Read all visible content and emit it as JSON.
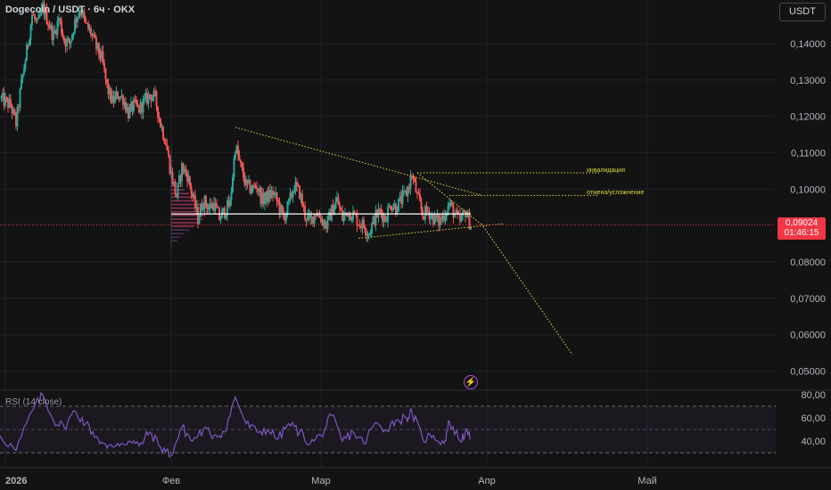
{
  "header": {
    "title": "Dogecoin / USDT · 6ч · OKX"
  },
  "currency_button": "USDT",
  "indicator": {
    "label": "RSI (14 close)"
  },
  "last_price": {
    "value": "0,09024",
    "countdown": "01:46:15"
  },
  "annotations": [
    {
      "text": "инвалидация",
      "price": 0.1045
    },
    {
      "text": "отмена/усложнение",
      "price": 0.0983
    }
  ],
  "colors": {
    "up": "#26a69a",
    "down": "#ef5350",
    "rsi": "#7e57c2",
    "annotation": "#d9d440",
    "level": "#f23645"
  },
  "chart_data": {
    "type": "candlestick",
    "y_axis": {
      "ticks": [
        "0,14000",
        "0,13000",
        "0,12000",
        "0,11000",
        "0,10000",
        "0,08000",
        "0,07000",
        "0,06000",
        "0,05000"
      ],
      "values": [
        0.14,
        0.13,
        0.12,
        0.11,
        0.1,
        0.08,
        0.07,
        0.06,
        0.05
      ],
      "ylim": [
        0.045,
        0.152
      ]
    },
    "x_axis": {
      "ticks": [
        "2026",
        "Фев",
        "Мар",
        "Апр",
        "Май"
      ],
      "dates": [
        "2026-01-01",
        "2026-02-01",
        "2026-03-01",
        "2026-04-01",
        "2026-05-01"
      ],
      "xlim": [
        "2025-12-31",
        "2026-05-25"
      ]
    },
    "close_series": [
      {
        "date": "2025-12-31",
        "price": 0.125
      },
      {
        "date": "2026-01-02",
        "price": 0.123
      },
      {
        "date": "2026-01-03",
        "price": 0.118
      },
      {
        "date": "2026-01-04",
        "price": 0.129
      },
      {
        "date": "2026-01-05",
        "price": 0.138
      },
      {
        "date": "2026-01-06",
        "price": 0.148
      },
      {
        "date": "2026-01-07",
        "price": 0.145
      },
      {
        "date": "2026-01-08",
        "price": 0.15
      },
      {
        "date": "2026-01-09",
        "price": 0.146
      },
      {
        "date": "2026-01-10",
        "price": 0.142
      },
      {
        "date": "2026-01-11",
        "price": 0.147
      },
      {
        "date": "2026-01-12",
        "price": 0.141
      },
      {
        "date": "2026-01-13",
        "price": 0.14
      },
      {
        "date": "2026-01-14",
        "price": 0.146
      },
      {
        "date": "2026-01-15",
        "price": 0.15
      },
      {
        "date": "2026-01-16",
        "price": 0.145
      },
      {
        "date": "2026-01-17",
        "price": 0.143
      },
      {
        "date": "2026-01-18",
        "price": 0.139
      },
      {
        "date": "2026-01-19",
        "price": 0.136
      },
      {
        "date": "2026-01-20",
        "price": 0.128
      },
      {
        "date": "2026-01-21",
        "price": 0.124
      },
      {
        "date": "2026-01-22",
        "price": 0.126
      },
      {
        "date": "2026-01-23",
        "price": 0.125
      },
      {
        "date": "2026-01-24",
        "price": 0.121
      },
      {
        "date": "2026-01-25",
        "price": 0.123
      },
      {
        "date": "2026-01-26",
        "price": 0.122
      },
      {
        "date": "2026-01-27",
        "price": 0.124
      },
      {
        "date": "2026-01-28",
        "price": 0.126
      },
      {
        "date": "2026-01-29",
        "price": 0.125
      },
      {
        "date": "2026-01-30",
        "price": 0.118
      },
      {
        "date": "2026-01-31",
        "price": 0.113
      },
      {
        "date": "2026-02-01",
        "price": 0.104
      },
      {
        "date": "2026-02-02",
        "price": 0.098
      },
      {
        "date": "2026-02-03",
        "price": 0.106
      },
      {
        "date": "2026-02-04",
        "price": 0.104
      },
      {
        "date": "2026-02-05",
        "price": 0.098
      },
      {
        "date": "2026-02-06",
        "price": 0.092
      },
      {
        "date": "2026-02-07",
        "price": 0.097
      },
      {
        "date": "2026-02-08",
        "price": 0.095
      },
      {
        "date": "2026-02-09",
        "price": 0.096
      },
      {
        "date": "2026-02-10",
        "price": 0.092
      },
      {
        "date": "2026-02-11",
        "price": 0.094
      },
      {
        "date": "2026-02-12",
        "price": 0.096
      },
      {
        "date": "2026-02-13",
        "price": 0.112
      },
      {
        "date": "2026-02-14",
        "price": 0.106
      },
      {
        "date": "2026-02-15",
        "price": 0.101
      },
      {
        "date": "2026-02-16",
        "price": 0.1
      },
      {
        "date": "2026-02-17",
        "price": 0.101
      },
      {
        "date": "2026-02-18",
        "price": 0.097
      },
      {
        "date": "2026-02-19",
        "price": 0.098
      },
      {
        "date": "2026-02-20",
        "price": 0.099
      },
      {
        "date": "2026-02-21",
        "price": 0.096
      },
      {
        "date": "2026-02-22",
        "price": 0.092
      },
      {
        "date": "2026-02-23",
        "price": 0.096
      },
      {
        "date": "2026-02-24",
        "price": 0.101
      },
      {
        "date": "2026-02-25",
        "price": 0.099
      },
      {
        "date": "2026-02-26",
        "price": 0.093
      },
      {
        "date": "2026-02-27",
        "price": 0.091
      },
      {
        "date": "2026-02-28",
        "price": 0.094
      },
      {
        "date": "2026-03-01",
        "price": 0.092
      },
      {
        "date": "2026-03-02",
        "price": 0.09
      },
      {
        "date": "2026-03-03",
        "price": 0.094
      },
      {
        "date": "2026-03-04",
        "price": 0.097
      },
      {
        "date": "2026-03-05",
        "price": 0.092
      },
      {
        "date": "2026-03-06",
        "price": 0.094
      },
      {
        "date": "2026-03-07",
        "price": 0.093
      },
      {
        "date": "2026-03-08",
        "price": 0.091
      },
      {
        "date": "2026-03-09",
        "price": 0.09
      },
      {
        "date": "2026-03-10",
        "price": 0.088
      },
      {
        "date": "2026-03-11",
        "price": 0.092
      },
      {
        "date": "2026-03-12",
        "price": 0.094
      },
      {
        "date": "2026-03-13",
        "price": 0.092
      },
      {
        "date": "2026-03-14",
        "price": 0.096
      },
      {
        "date": "2026-03-15",
        "price": 0.095
      },
      {
        "date": "2026-03-16",
        "price": 0.097
      },
      {
        "date": "2026-03-17",
        "price": 0.099
      },
      {
        "date": "2026-03-18",
        "price": 0.104
      },
      {
        "date": "2026-03-19",
        "price": 0.098
      },
      {
        "date": "2026-03-20",
        "price": 0.093
      },
      {
        "date": "2026-03-21",
        "price": 0.094
      },
      {
        "date": "2026-03-22",
        "price": 0.092
      },
      {
        "date": "2026-03-23",
        "price": 0.091
      },
      {
        "date": "2026-03-24",
        "price": 0.093
      },
      {
        "date": "2026-03-25",
        "price": 0.096
      },
      {
        "date": "2026-03-26",
        "price": 0.093
      },
      {
        "date": "2026-03-27",
        "price": 0.091
      },
      {
        "date": "2026-03-28",
        "price": 0.094
      },
      {
        "date": "2026-03-29",
        "price": 0.09
      }
    ],
    "last_price": 0.09024,
    "horizontal_levels": [
      {
        "price": 0.0932,
        "from": "2026-02-01",
        "to": "2026-03-29"
      }
    ],
    "trendlines": [
      {
        "from": {
          "date": "2026-02-13",
          "price": 0.117
        },
        "to": {
          "date": "2026-03-31",
          "price": 0.0983
        }
      },
      {
        "from": {
          "date": "2026-03-08",
          "price": 0.0865
        },
        "to": {
          "date": "2026-04-04",
          "price": 0.0905
        }
      },
      {
        "from": {
          "date": "2026-03-19",
          "price": 0.1045
        },
        "to": {
          "date": "2026-03-31",
          "price": 0.0903
        }
      },
      {
        "from": {
          "date": "2026-03-31",
          "price": 0.0905
        },
        "to": {
          "date": "2026-04-17",
          "price": 0.0545
        }
      }
    ],
    "annotation_lines": [
      {
        "price": 0.1045,
        "from": "2026-03-19",
        "to": "2026-04-22"
      },
      {
        "price": 0.0983,
        "from": "2026-03-25",
        "to": "2026-04-22"
      }
    ],
    "rsi": {
      "ticks": [
        "80,00",
        "60,00",
        "40,00"
      ],
      "values": [
        80,
        60,
        40
      ],
      "ylim": [
        18,
        83
      ],
      "bands": [
        70,
        50,
        30
      ],
      "series": [
        {
          "date": "2025-12-31",
          "value": 45
        },
        {
          "date": "2026-01-03",
          "value": 32
        },
        {
          "date": "2026-01-06",
          "value": 66
        },
        {
          "date": "2026-01-08",
          "value": 80
        },
        {
          "date": "2026-01-10",
          "value": 58
        },
        {
          "date": "2026-01-12",
          "value": 52
        },
        {
          "date": "2026-01-14",
          "value": 66
        },
        {
          "date": "2026-01-16",
          "value": 55
        },
        {
          "date": "2026-01-18",
          "value": 44
        },
        {
          "date": "2026-01-20",
          "value": 34
        },
        {
          "date": "2026-01-22",
          "value": 38
        },
        {
          "date": "2026-01-24",
          "value": 40
        },
        {
          "date": "2026-01-26",
          "value": 36
        },
        {
          "date": "2026-01-28",
          "value": 48
        },
        {
          "date": "2026-01-30",
          "value": 35
        },
        {
          "date": "2026-02-01",
          "value": 28
        },
        {
          "date": "2026-02-03",
          "value": 52
        },
        {
          "date": "2026-02-05",
          "value": 40
        },
        {
          "date": "2026-02-07",
          "value": 50
        },
        {
          "date": "2026-02-09",
          "value": 45
        },
        {
          "date": "2026-02-11",
          "value": 48
        },
        {
          "date": "2026-02-13",
          "value": 78
        },
        {
          "date": "2026-02-15",
          "value": 55
        },
        {
          "date": "2026-02-17",
          "value": 48
        },
        {
          "date": "2026-02-19",
          "value": 50
        },
        {
          "date": "2026-02-21",
          "value": 42
        },
        {
          "date": "2026-02-23",
          "value": 55
        },
        {
          "date": "2026-02-25",
          "value": 48
        },
        {
          "date": "2026-02-27",
          "value": 38
        },
        {
          "date": "2026-03-01",
          "value": 45
        },
        {
          "date": "2026-03-03",
          "value": 62
        },
        {
          "date": "2026-03-05",
          "value": 40
        },
        {
          "date": "2026-03-07",
          "value": 48
        },
        {
          "date": "2026-03-09",
          "value": 38
        },
        {
          "date": "2026-03-11",
          "value": 55
        },
        {
          "date": "2026-03-13",
          "value": 50
        },
        {
          "date": "2026-03-15",
          "value": 58
        },
        {
          "date": "2026-03-17",
          "value": 60
        },
        {
          "date": "2026-03-18",
          "value": 65
        },
        {
          "date": "2026-03-20",
          "value": 42
        },
        {
          "date": "2026-03-22",
          "value": 45
        },
        {
          "date": "2026-03-24",
          "value": 38
        },
        {
          "date": "2026-03-25",
          "value": 57
        },
        {
          "date": "2026-03-27",
          "value": 40
        },
        {
          "date": "2026-03-28",
          "value": 48
        },
        {
          "date": "2026-03-29",
          "value": 42
        }
      ]
    }
  }
}
